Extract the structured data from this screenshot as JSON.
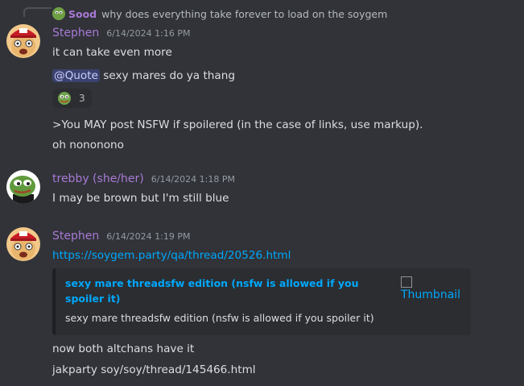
{
  "reply": {
    "author": "Sood",
    "text": "why does everything take forever to load on the soygem"
  },
  "messages": [
    {
      "author": "Stephen",
      "timestamp": "6/14/2024 1:16 PM",
      "lines": [
        "it can take even more",
        "sexy mares do ya thang",
        ">You MAY post NSFW if spoilered (in the case of links, use markup).",
        "oh nononono"
      ],
      "mention": "@Quote",
      "reaction": {
        "icon": "pepe-emoji-icon",
        "count": "3"
      }
    },
    {
      "author": "trebby (she/her)",
      "timestamp": "6/14/2024 1:18 PM",
      "lines": [
        "I may be brown but I'm still blue"
      ]
    },
    {
      "author": "Stephen",
      "timestamp": "6/14/2024 1:19 PM",
      "link": "https://soygem.party/qa/thread/20526.html",
      "embed": {
        "title": "sexy mare threadsfw edition (nsfw is allowed if you spoiler it)",
        "description": "sexy mare threadsfw edition (nsfw is allowed if you spoiler it)",
        "thumbnail_alt": "Thumbnail"
      },
      "lines": [
        "now both altchans have it",
        "jakparty soy/soy/thread/145466.html"
      ]
    }
  ],
  "colors": {
    "background": "#313338",
    "author": "#a879d6",
    "link": "#00a8fc",
    "mention_bg": "#3c4270"
  }
}
